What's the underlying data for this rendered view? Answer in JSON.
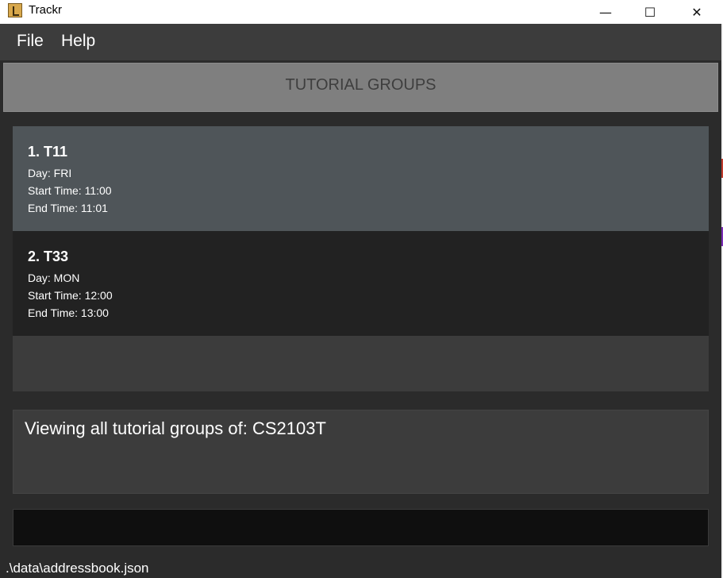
{
  "window": {
    "title": "Trackr",
    "icon": "trackr-app-icon",
    "minimize_glyph": "—",
    "maximize_glyph": "☐",
    "close_glyph": "✕"
  },
  "menu": {
    "items": [
      {
        "label": "File"
      },
      {
        "label": "Help"
      }
    ]
  },
  "header": {
    "title": "TUTORIAL GROUPS"
  },
  "groups": [
    {
      "title": "1.  T11",
      "day": "Day: FRI",
      "start": "Start Time: 11:00",
      "end": "End Time: 11:01",
      "selected": true
    },
    {
      "title": "2.  T33",
      "day": "Day: MON",
      "start": "Start Time: 12:00",
      "end": "End Time: 13:00",
      "selected": false
    }
  ],
  "result": {
    "message": "Viewing all tutorial groups of: CS2103T"
  },
  "command": {
    "value": ""
  },
  "status": {
    "path": ".\\data\\addressbook.json"
  },
  "colors": {
    "background": "#2b2b2b",
    "menubar": "#3c3c3c",
    "header_panel": "#7f7f7f",
    "selected_card": "#4f5559",
    "unselected_card": "#222222",
    "command_box": "#0f0f0f"
  }
}
